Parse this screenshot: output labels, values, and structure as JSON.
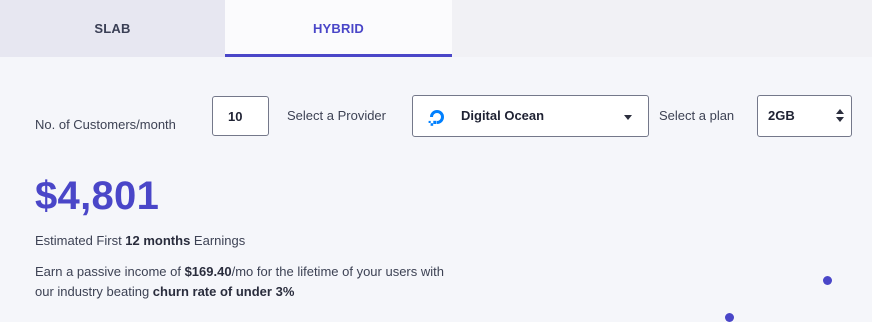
{
  "tabs": [
    {
      "label": "SLAB",
      "active": false
    },
    {
      "label": "HYBRID",
      "active": true
    }
  ],
  "form": {
    "customers_label": "No. of Customers/month",
    "customers_value": "10",
    "provider_label": "Select a Provider",
    "provider_value": "Digital Ocean",
    "provider_icon": "digitalocean-logo-icon",
    "plan_label": "Select a plan",
    "plan_value": "2GB"
  },
  "result": {
    "earnings": "$4,801",
    "est_prefix": "Estimated First ",
    "est_bold": "12 months",
    "est_suffix": " Earnings",
    "passive_1": "Earn a passive income of ",
    "passive_amount": "$169.40",
    "passive_2": "/mo for the lifetime of your users with our industry beating ",
    "passive_bold": "churn rate of under 3%"
  },
  "colors": {
    "accent": "#4a46c8",
    "background": "#f5f6fa",
    "text": "#3d4254",
    "logo_blue": "#0080ff"
  }
}
